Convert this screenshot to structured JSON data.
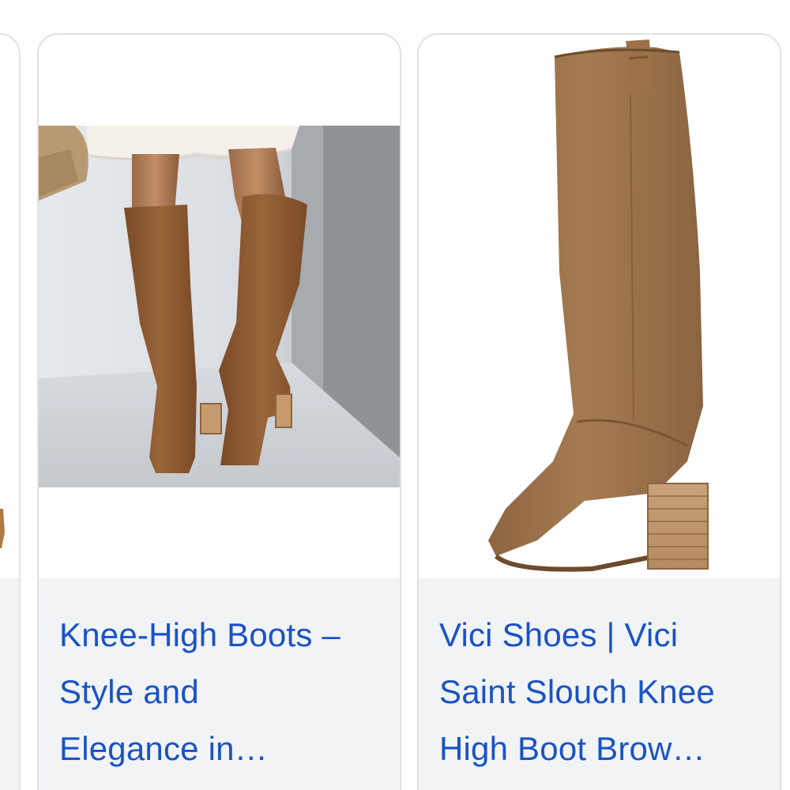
{
  "results": [
    {
      "image_alt": "Woman wearing brown suede knee-high boots with block heels",
      "title_lines": [
        "Knee-High Boots –",
        "Style and",
        "Elegance in…"
      ],
      "link_color": "#1a53c4"
    },
    {
      "image_alt": "Single tan suede knee-high boot with stacked wood block heel",
      "title_lines": [
        "Vici Shoes | Vici",
        "Saint Slouch Knee",
        "High Boot Brow…"
      ],
      "link_color": "#1a53c4"
    }
  ],
  "colors": {
    "card_border": "#dfe1e5",
    "caption_background": "#f1f3f4",
    "suede_brown": "#8c5a33",
    "tan_suede": "#a2774d"
  }
}
